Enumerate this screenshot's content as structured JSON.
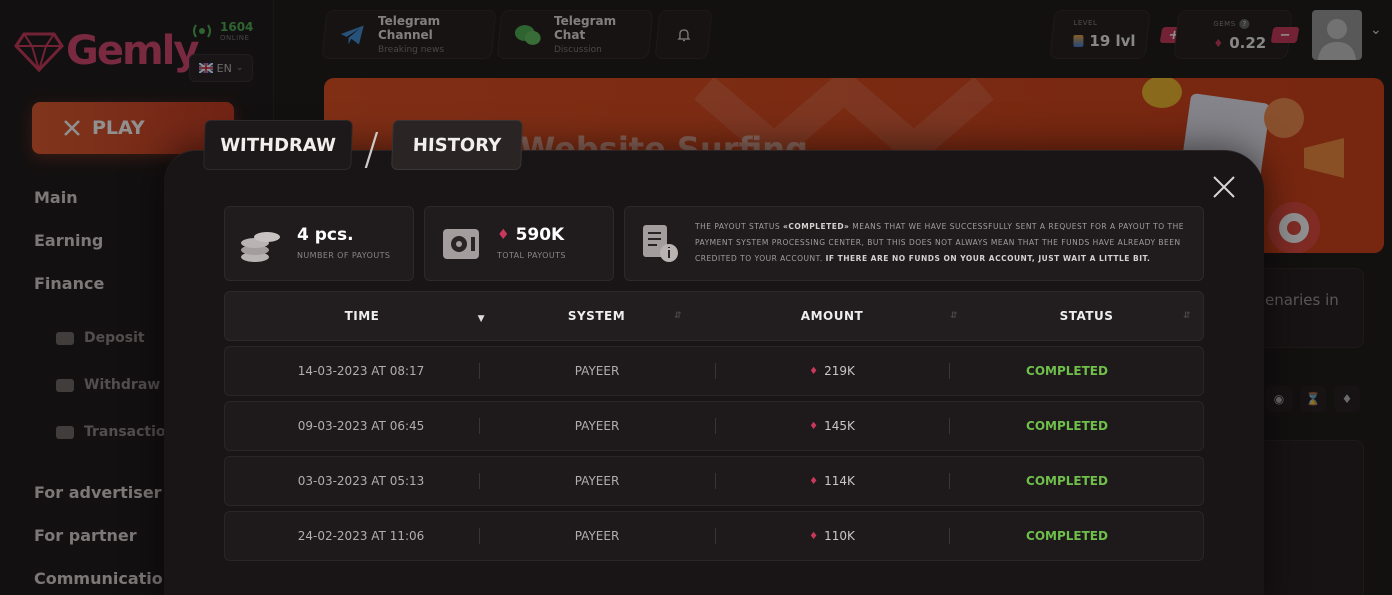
{
  "logo": {
    "text": "Gemly"
  },
  "online": {
    "count": "1604",
    "label": "ONLINE"
  },
  "language": {
    "code": "EN"
  },
  "sidebar": {
    "play_label": "PLAY",
    "items": [
      {
        "label": "Main"
      },
      {
        "label": "Earning"
      },
      {
        "label": "Finance"
      },
      {
        "label": "For advertiser"
      },
      {
        "label": "For partner"
      },
      {
        "label": "Communication"
      }
    ],
    "finance_sub": [
      {
        "label": "Deposit"
      },
      {
        "label": "Withdraw"
      },
      {
        "label": "Transaction"
      }
    ]
  },
  "topbar": {
    "telegram_channel": {
      "title": "Telegram Channel",
      "subtitle": "Breaking news"
    },
    "telegram_chat": {
      "title": "Telegram Chat",
      "subtitle": "Discussion"
    },
    "level": {
      "label": "LEVEL",
      "value": "19 lvl"
    },
    "gems": {
      "label": "GEMS",
      "value": "0.22",
      "plus": "+",
      "minus": "−"
    }
  },
  "banner": {
    "title": "Website Surfing"
  },
  "side_card": {
    "text": "enaries in"
  },
  "modal": {
    "tabs": [
      {
        "label": "WITHDRAW"
      },
      {
        "label": "HISTORY"
      }
    ],
    "active_tab": "HISTORY",
    "payouts_count": {
      "value": "4 pcs.",
      "label": "NUMBER OF PAYOUTS"
    },
    "payouts_total": {
      "value": "590K",
      "label": "TOTAL PAYOUTS"
    },
    "notice": {
      "text1": "The payout status ",
      "highlight": "«completed»",
      "text2": " means that we have successfully sent a request for a payout to the payment system processing center, but this does not always mean that the funds have already been credited to your account. ",
      "bold": "If there are no funds on your account, just wait a little bit."
    },
    "columns": [
      "TIME",
      "SYSTEM",
      "AMOUNT",
      "STATUS"
    ],
    "rows": [
      {
        "time": "14-03-2023 AT 08:17",
        "system": "PAYEER",
        "amount": "219K",
        "status": "COMPLETED"
      },
      {
        "time": "09-03-2023 AT 06:45",
        "system": "PAYEER",
        "amount": "145K",
        "status": "COMPLETED"
      },
      {
        "time": "03-03-2023 AT 05:13",
        "system": "PAYEER",
        "amount": "114K",
        "status": "COMPLETED"
      },
      {
        "time": "24-02-2023 AT 11:06",
        "system": "PAYEER",
        "amount": "110K",
        "status": "COMPLETED"
      }
    ]
  },
  "colors": {
    "accent": "#c9375a",
    "play": "#e25a2c",
    "completed": "#6fbf4b",
    "online": "#4caf50"
  }
}
